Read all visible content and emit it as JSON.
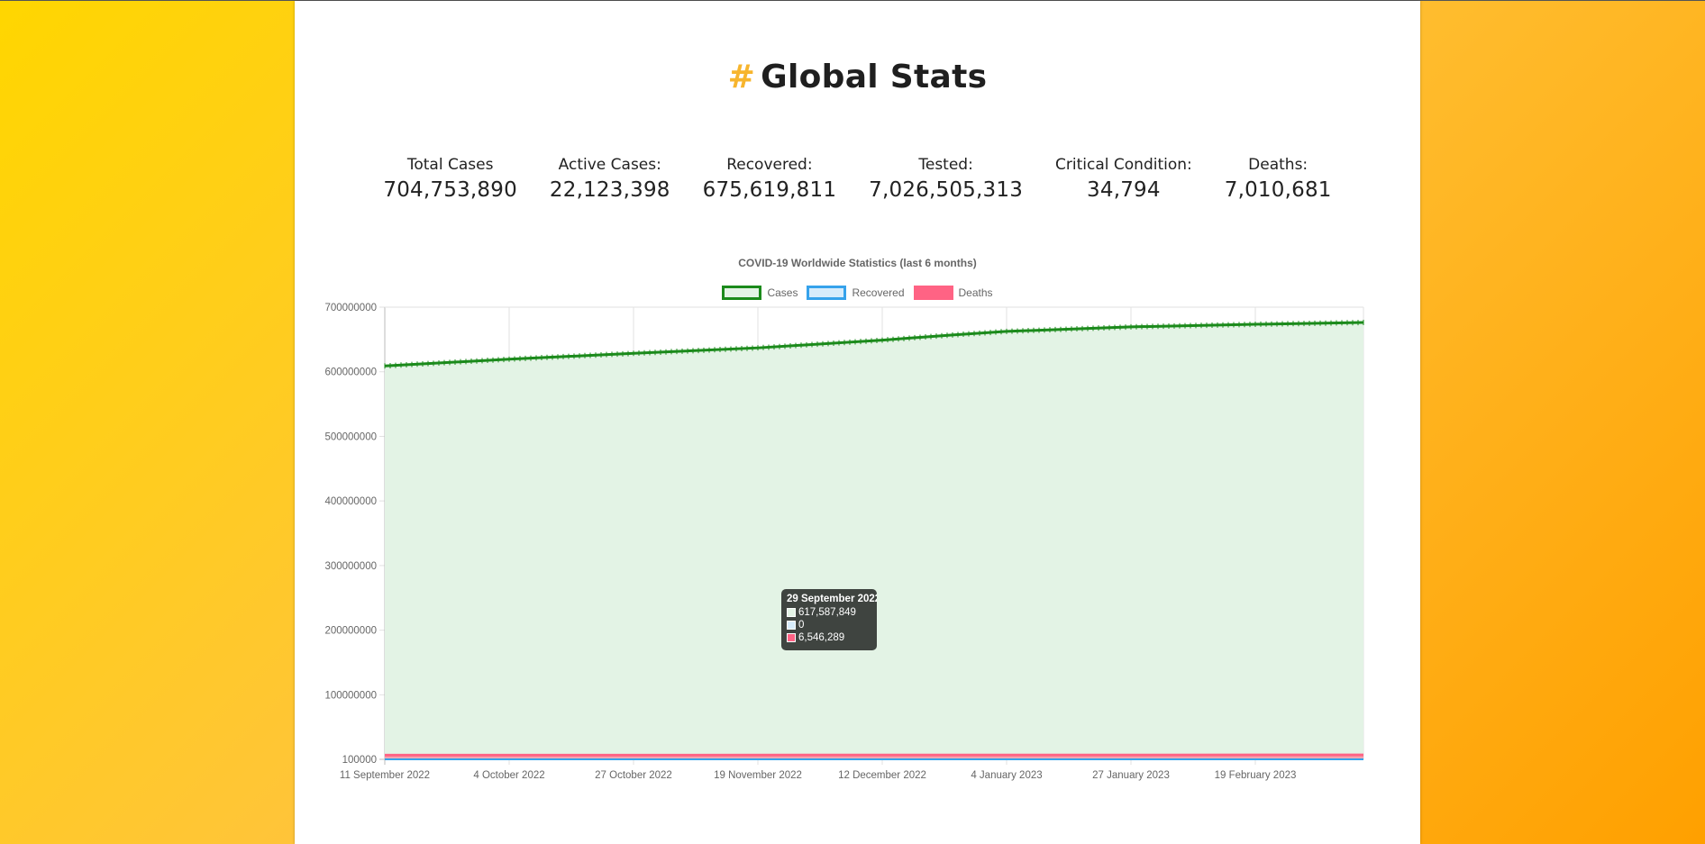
{
  "page": {
    "hash": "#",
    "title": "Global Stats"
  },
  "stats": [
    {
      "label": "Total Cases",
      "value": "704,753,890"
    },
    {
      "label": "Active Cases:",
      "value": "22,123,398"
    },
    {
      "label": "Recovered:",
      "value": "675,619,811"
    },
    {
      "label": "Tested:",
      "value": "7,026,505,313"
    },
    {
      "label": "Critical Condition:",
      "value": "34,794"
    },
    {
      "label": "Deaths:",
      "value": "7,010,681"
    }
  ],
  "colors": {
    "accent": "#f7b52d",
    "cases_line": "#1b8a1b",
    "cases_fill": "#e3f3e5",
    "recovered_line": "#36a2eb",
    "recovered_fill": "#d7ecfb",
    "deaths_line": "#ff6384",
    "deaths_fill": "#ff6384"
  },
  "chart_data": {
    "type": "line",
    "title": "COVID-19 Worldwide Statistics (last 6 months)",
    "legend_position": "top",
    "grid": true,
    "x_tick_labels": [
      "11 September 2022",
      "4 October 2022",
      "27 October 2022",
      "19 November 2022",
      "12 December 2022",
      "4 January 2023",
      "27 January 2023",
      "19 February 2023"
    ],
    "x_range": [
      "2022-09-11",
      "2023-03-11"
    ],
    "y_tick_labels": [
      "700000000",
      "600000000",
      "500000000",
      "400000000",
      "300000000",
      "200000000",
      "100000000",
      "100000"
    ],
    "ylim": [
      100000,
      700000000
    ],
    "series": [
      {
        "name": "Cases",
        "points": [
          [
            "2022-09-11",
            609000000
          ],
          [
            "2022-10-04",
            619500000
          ],
          [
            "2022-10-27",
            628500000
          ],
          [
            "2022-11-19",
            637000000
          ],
          [
            "2022-12-12",
            649000000
          ],
          [
            "2022-12-25",
            657000000
          ],
          [
            "2023-01-04",
            662500000
          ],
          [
            "2023-01-27",
            669500000
          ],
          [
            "2023-02-19",
            673500000
          ],
          [
            "2023-03-11",
            676300000
          ]
        ]
      },
      {
        "name": "Recovered",
        "points": [
          [
            "2022-09-11",
            0
          ],
          [
            "2023-03-11",
            0
          ]
        ]
      },
      {
        "name": "Deaths",
        "points": [
          [
            "2022-09-11",
            6530000
          ],
          [
            "2022-10-27",
            6590000
          ],
          [
            "2022-12-12",
            6660000
          ],
          [
            "2023-01-27",
            6790000
          ],
          [
            "2023-03-11",
            6880000
          ]
        ]
      }
    ],
    "tooltip": {
      "date": "29 September 2022",
      "cases": "617,587,849",
      "recovered": "0",
      "deaths": "6,546,289"
    }
  }
}
